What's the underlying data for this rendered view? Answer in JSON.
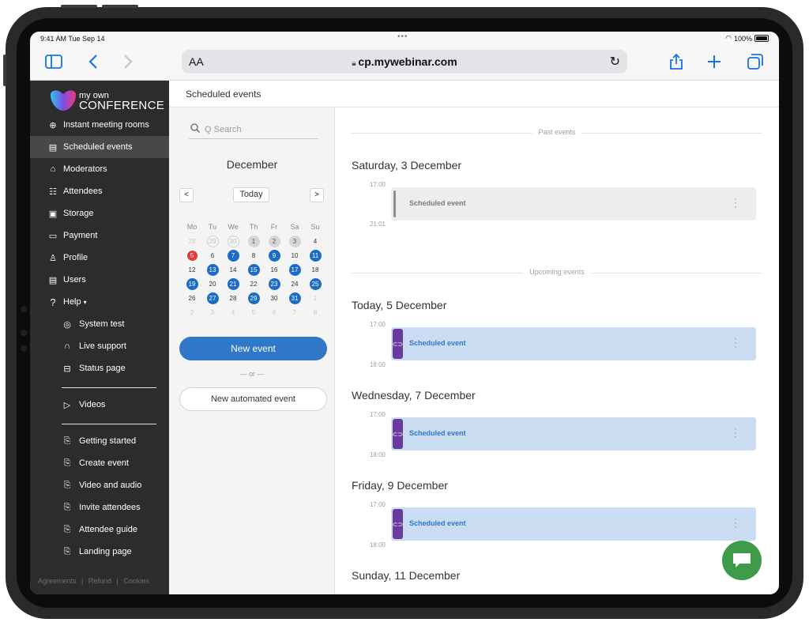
{
  "status_bar": {
    "time": "9:41 AM  Tue Sep 14",
    "dots": "•••",
    "battery": "100%"
  },
  "browser": {
    "aa": "AA",
    "url": "cp.mywebinar.com"
  },
  "logo": {
    "line1": "my own",
    "line2": "CONFERENCE"
  },
  "sidebar": {
    "items": [
      {
        "label": "Instant meeting rooms",
        "icon": "instant-room-icon"
      },
      {
        "label": "Scheduled events",
        "icon": "calendar-icon"
      },
      {
        "label": "Moderators",
        "icon": "moderator-icon"
      },
      {
        "label": "Attendees",
        "icon": "attendees-icon"
      },
      {
        "label": "Storage",
        "icon": "storage-icon"
      },
      {
        "label": "Payment",
        "icon": "card-icon"
      },
      {
        "label": "Profile",
        "icon": "profile-icon"
      },
      {
        "label": "Users",
        "icon": "users-icon"
      },
      {
        "label": "Help",
        "icon": "help-icon"
      },
      {
        "label": "System test",
        "icon": "system-test-icon"
      },
      {
        "label": "Live support",
        "icon": "headset-icon"
      },
      {
        "label": "Status page",
        "icon": "status-icon"
      },
      {
        "label": "Videos",
        "icon": "video-icon"
      },
      {
        "label": "Getting started",
        "icon": "doc-icon"
      },
      {
        "label": "Create event",
        "icon": "doc-icon"
      },
      {
        "label": "Video and audio",
        "icon": "doc-icon"
      },
      {
        "label": "Invite attendees",
        "icon": "doc-icon"
      },
      {
        "label": "Attendee guide",
        "icon": "doc-icon"
      },
      {
        "label": "Landing page",
        "icon": "doc-icon"
      }
    ],
    "footer": [
      "Agreements",
      "Refund",
      "Cookies"
    ]
  },
  "header": {
    "title": "Scheduled events"
  },
  "calendar": {
    "search_placeholder": "Q Search",
    "month": "December",
    "today_label": "Today",
    "prev": "<",
    "next": ">",
    "weekdays": [
      "Mo",
      "Tu",
      "We",
      "Th",
      "Fr",
      "Sa",
      "Su"
    ],
    "weeks": [
      [
        {
          "d": "28",
          "s": "muted"
        },
        {
          "d": "29",
          "s": "outline"
        },
        {
          "d": "30",
          "s": "outline"
        },
        {
          "d": "1",
          "s": "grey"
        },
        {
          "d": "2",
          "s": "grey"
        },
        {
          "d": "3",
          "s": "grey"
        },
        {
          "d": "4",
          "s": ""
        }
      ],
      [
        {
          "d": "5",
          "s": "today"
        },
        {
          "d": "6",
          "s": ""
        },
        {
          "d": "7",
          "s": "ev"
        },
        {
          "d": "8",
          "s": ""
        },
        {
          "d": "9",
          "s": "ev"
        },
        {
          "d": "10",
          "s": ""
        },
        {
          "d": "11",
          "s": "ev"
        }
      ],
      [
        {
          "d": "12",
          "s": ""
        },
        {
          "d": "13",
          "s": "ev"
        },
        {
          "d": "14",
          "s": ""
        },
        {
          "d": "15",
          "s": "ev"
        },
        {
          "d": "16",
          "s": ""
        },
        {
          "d": "17",
          "s": "ev"
        },
        {
          "d": "18",
          "s": ""
        }
      ],
      [
        {
          "d": "19",
          "s": "ev"
        },
        {
          "d": "20",
          "s": ""
        },
        {
          "d": "21",
          "s": "ev"
        },
        {
          "d": "22",
          "s": ""
        },
        {
          "d": "23",
          "s": "ev"
        },
        {
          "d": "24",
          "s": ""
        },
        {
          "d": "25",
          "s": "ev"
        }
      ],
      [
        {
          "d": "26",
          "s": ""
        },
        {
          "d": "27",
          "s": "ev"
        },
        {
          "d": "28",
          "s": ""
        },
        {
          "d": "29",
          "s": "ev"
        },
        {
          "d": "30",
          "s": ""
        },
        {
          "d": "31",
          "s": "ev"
        },
        {
          "d": "1",
          "s": "muted"
        }
      ],
      [
        {
          "d": "2",
          "s": "muted"
        },
        {
          "d": "3",
          "s": "muted"
        },
        {
          "d": "4",
          "s": "muted"
        },
        {
          "d": "5",
          "s": "muted"
        },
        {
          "d": "6",
          "s": "muted"
        },
        {
          "d": "7",
          "s": "muted"
        },
        {
          "d": "8",
          "s": "muted"
        }
      ]
    ],
    "new_event": "New event",
    "or": "— or —",
    "new_automated": "New automated event"
  },
  "events": {
    "past_label": "Past events",
    "upcoming_label": "Upcoming events",
    "past_days": [
      {
        "title": "Saturday, 3 December",
        "start": "17:00",
        "end": "21:01",
        "event": "Scheduled event"
      }
    ],
    "upcoming_days": [
      {
        "title": "Today, 5 December",
        "start": "17:00",
        "end": "18:00",
        "event": "Scheduled event"
      },
      {
        "title": "Wednesday, 7 December",
        "start": "17:00",
        "end": "18:00",
        "event": "Scheduled event"
      },
      {
        "title": "Friday, 9 December",
        "start": "17:00",
        "end": "18:00",
        "event": "Scheduled event"
      }
    ],
    "next_day_title": "Sunday, 11 December"
  },
  "colors": {
    "accent": "#2e78c7",
    "sidebar_bg": "#2c2c2e",
    "event_bg": "#c9dcf1",
    "badge": "#6a3b9e",
    "today": "#e53935",
    "chat": "#3d9b4a"
  }
}
